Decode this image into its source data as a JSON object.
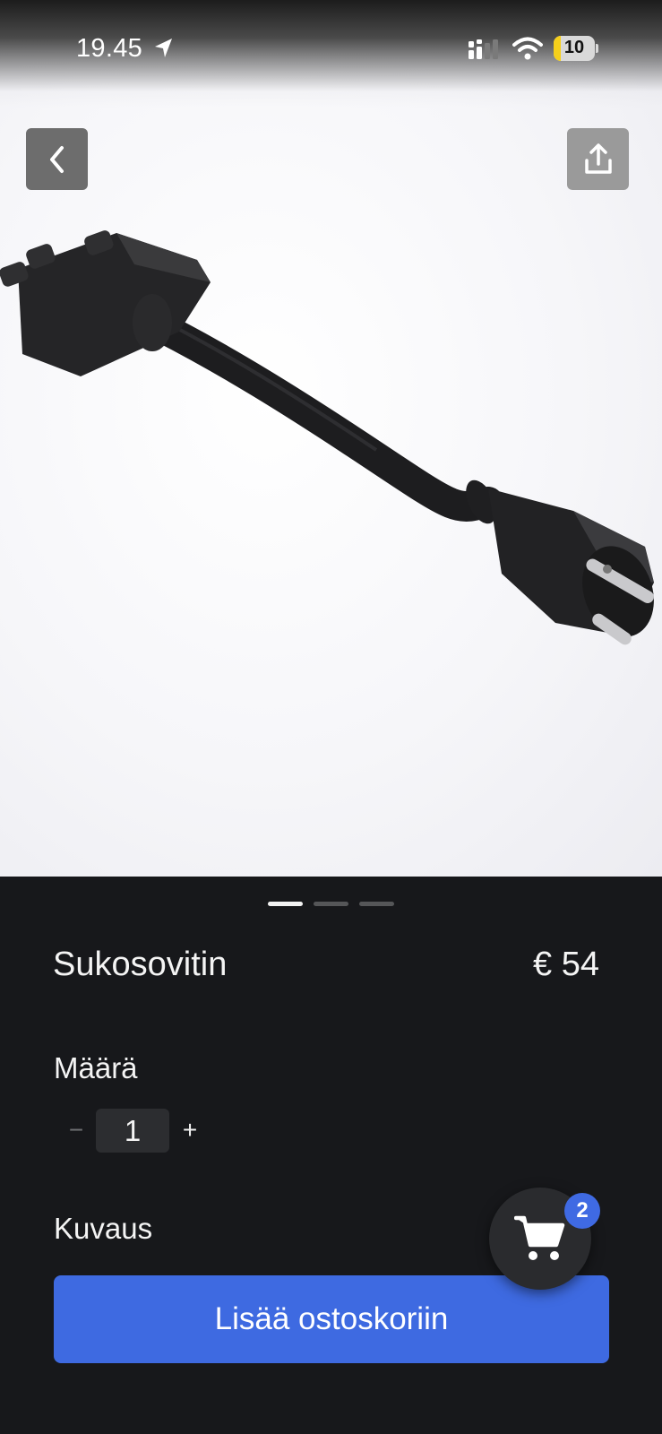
{
  "status_bar": {
    "time": "19.45",
    "battery_level": "10",
    "icons": [
      "location-arrow-icon",
      "signal-icon",
      "wifi-icon",
      "battery-icon"
    ]
  },
  "navigation": {
    "back_icon": "chevron-left-icon",
    "share_icon": "share-icon"
  },
  "gallery": {
    "image_count": 3,
    "active_index": 0
  },
  "product": {
    "name": "Sukosovitin",
    "price": "€ 54"
  },
  "quantity": {
    "label": "Määrä",
    "minus": "−",
    "value": "1",
    "plus": "+"
  },
  "description": {
    "label": "Kuvaus"
  },
  "cart": {
    "icon": "cart-icon",
    "badge_count": "2"
  },
  "actions": {
    "add_to_cart_label": "Lisää ostoskoriin"
  },
  "colors": {
    "background": "#17181b",
    "accent": "#3e6ae1",
    "battery_low": "#f5cf1b"
  }
}
